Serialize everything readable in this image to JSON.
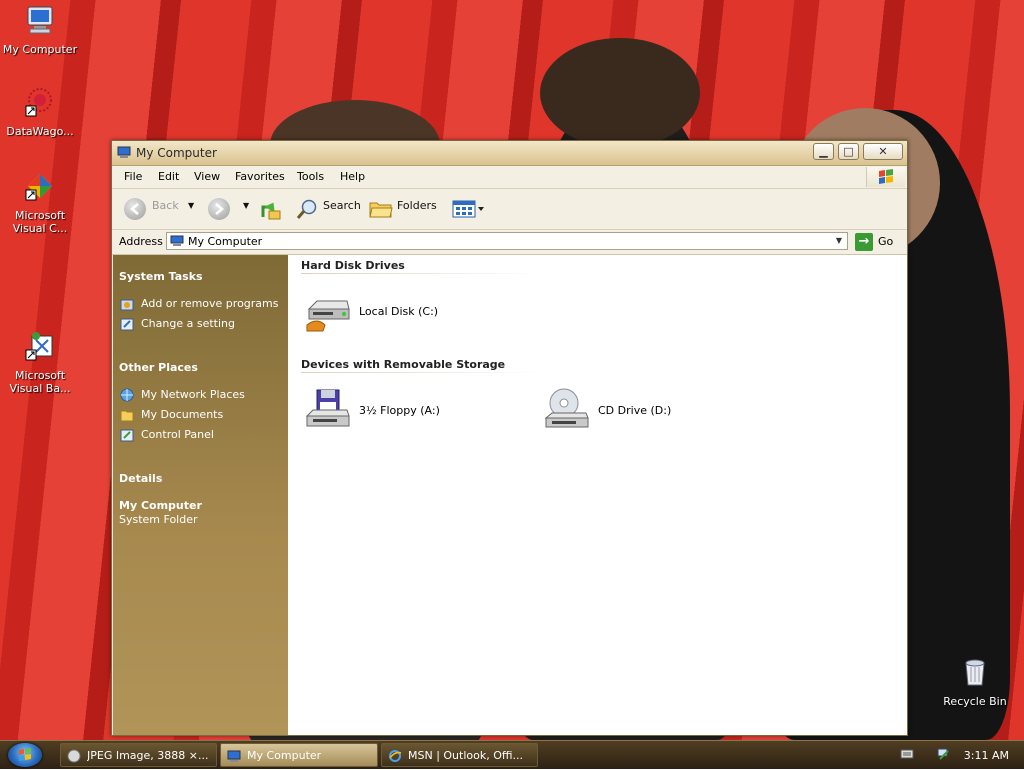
{
  "desktop": {
    "icons": [
      {
        "label": "My Computer"
      },
      {
        "label": "DataWago..."
      },
      {
        "label": "Microsoft Visual C..."
      },
      {
        "label": "Microsoft Visual Ba..."
      },
      {
        "label": "Recycle Bin"
      }
    ]
  },
  "window": {
    "title": "My Computer",
    "controls": {
      "minimize": "▁",
      "maximize": "□",
      "close": "✕"
    },
    "menu": [
      "File",
      "Edit",
      "View",
      "Favorites",
      "Tools",
      "Help"
    ],
    "toolbar": {
      "back": "Back",
      "search": "Search",
      "folders": "Folders"
    },
    "address": {
      "label": "Address",
      "value": "My Computer",
      "go": "Go"
    },
    "left_pane": {
      "system_tasks": {
        "heading": "System Tasks",
        "items": [
          "Add or remove programs",
          "Change a setting"
        ]
      },
      "other_places": {
        "heading": "Other Places",
        "items": [
          "My Network Places",
          "My Documents",
          "Control Panel"
        ]
      },
      "details": {
        "heading": "Details",
        "name": "My Computer",
        "type": "System Folder"
      }
    },
    "content": {
      "groups": [
        {
          "heading": "Hard Disk Drives",
          "items": [
            "Local Disk (C:)"
          ]
        },
        {
          "heading": "Devices with Removable Storage",
          "items": [
            "3½ Floppy (A:)",
            "CD Drive (D:)"
          ]
        }
      ]
    }
  },
  "taskbar": {
    "tasks": [
      {
        "label": "JPEG Image, 3888 ×..."
      },
      {
        "label": "My Computer"
      },
      {
        "label": "MSN | Outlook, Offi..."
      }
    ],
    "clock": "3:11 AM"
  },
  "colors": {
    "wallpaper_red": "#e0352b",
    "left_pane": "#a88a4f",
    "title_bar": "#d9c28f",
    "taskbar": "#3e311b"
  }
}
